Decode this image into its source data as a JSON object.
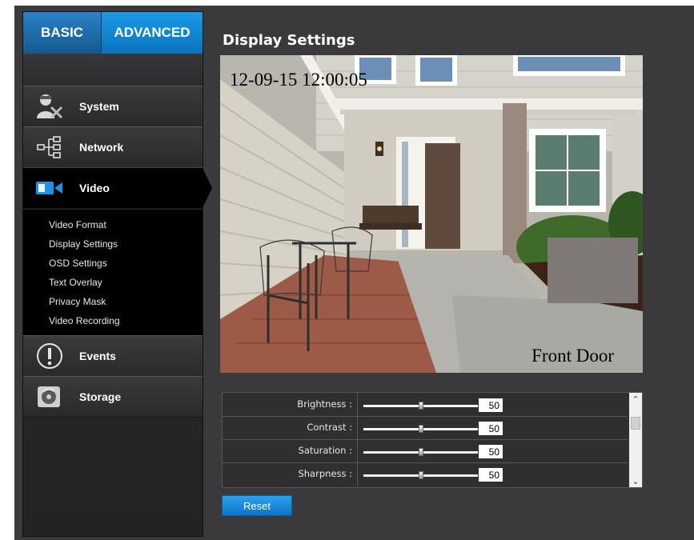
{
  "tabs": {
    "basic": "BASIC",
    "advanced": "ADVANCED"
  },
  "sidebar": {
    "items": [
      {
        "label": "System",
        "icon": "system-user-tools-icon"
      },
      {
        "label": "Network",
        "icon": "network-icon"
      },
      {
        "label": "Video",
        "icon": "video-camera-icon",
        "active": true
      },
      {
        "label": "Events",
        "icon": "exclamation-icon"
      },
      {
        "label": "Storage",
        "icon": "storage-disk-icon"
      }
    ],
    "video_submenu": [
      "Video Format",
      "Display Settings",
      "OSD Settings",
      "Text Overlay",
      "Privacy Mask",
      "Video Recording"
    ]
  },
  "page": {
    "title": "Display Settings"
  },
  "preview": {
    "timestamp": "12-09-15 12:00:05",
    "overlay_text": "Front Door"
  },
  "settings": [
    {
      "label": "Brightness :",
      "value": "50",
      "level_fraction": 0.5
    },
    {
      "label": "Contrast :",
      "value": "50",
      "level_fraction": 0.5
    },
    {
      "label": "Saturation :",
      "value": "50",
      "level_fraction": 0.5
    },
    {
      "label": "Sharpness :",
      "value": "50",
      "level_fraction": 0.5
    }
  ],
  "buttons": {
    "reset": "Reset"
  },
  "colors": {
    "accent": "#1b9ae6",
    "basic_tab": "#1f6fae",
    "frame": "#3a3a3c"
  }
}
